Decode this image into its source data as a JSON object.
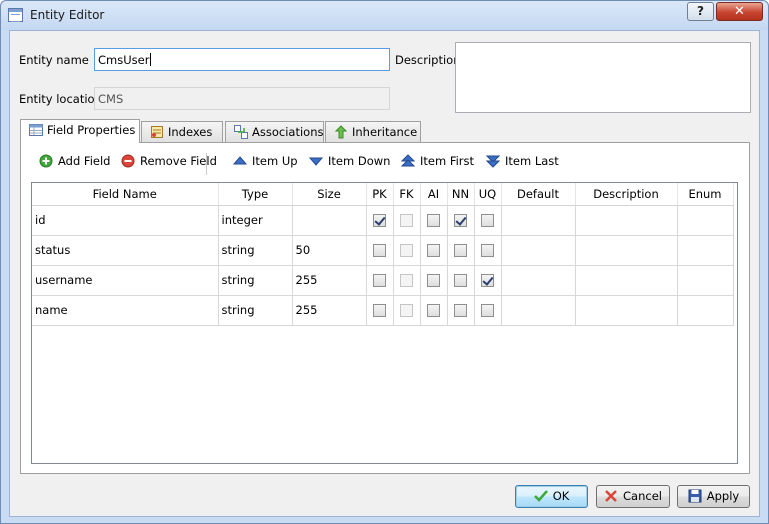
{
  "window": {
    "title": "Entity Editor",
    "help_label": "?",
    "close_label": "✕"
  },
  "form": {
    "entity_name_label": "Entity name",
    "entity_name_value": "CmsUser",
    "entity_location_label": "Entity location",
    "entity_location_value": "CMS",
    "description_label": "Description",
    "description_value": ""
  },
  "tabs": [
    {
      "label": "Field Properties",
      "icon": "table-icon",
      "active": true
    },
    {
      "label": "Indexes",
      "icon": "index-icon",
      "active": false
    },
    {
      "label": "Associations",
      "icon": "associations-icon",
      "active": false
    },
    {
      "label": "Inheritance",
      "icon": "inheritance-arrow-icon",
      "active": false
    }
  ],
  "toolbar": {
    "add_field": "Add Field",
    "remove_field": "Remove Field",
    "item_up": "Item Up",
    "item_down": "Item Down",
    "item_first": "Item First",
    "item_last": "Item Last"
  },
  "grid": {
    "columns": [
      "Field Name",
      "Type",
      "Size",
      "PK",
      "FK",
      "AI",
      "NN",
      "UQ",
      "Default",
      "Description",
      "Enum"
    ],
    "rows": [
      {
        "name": "id",
        "type": "integer",
        "size": "",
        "pk": true,
        "fk": false,
        "ai": false,
        "nn": true,
        "uq": false,
        "default": "",
        "description": "",
        "enum": ""
      },
      {
        "name": "status",
        "type": "string",
        "size": "50",
        "pk": false,
        "fk": false,
        "ai": false,
        "nn": false,
        "uq": false,
        "default": "",
        "description": "",
        "enum": ""
      },
      {
        "name": "username",
        "type": "string",
        "size": "255",
        "pk": false,
        "fk": false,
        "ai": false,
        "nn": false,
        "uq": true,
        "default": "",
        "description": "",
        "enum": ""
      },
      {
        "name": "name",
        "type": "string",
        "size": "255",
        "pk": false,
        "fk": false,
        "ai": false,
        "nn": false,
        "uq": false,
        "default": "",
        "description": "",
        "enum": ""
      }
    ]
  },
  "buttons": {
    "ok": "OK",
    "cancel": "Cancel",
    "apply": "Apply"
  },
  "colors": {
    "add_green": "#3ea83a",
    "remove_red": "#d9463a",
    "arrow_blue": "#3a6fc9",
    "titlebar": "#c9dcf3"
  }
}
